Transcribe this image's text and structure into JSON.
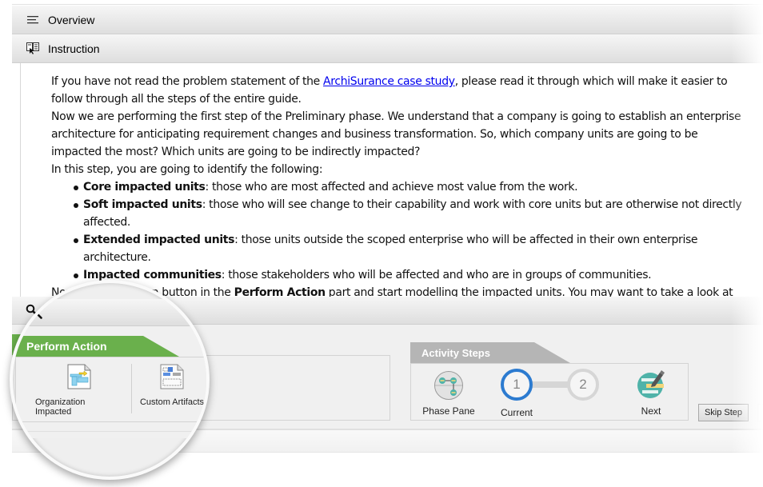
{
  "overview": {
    "title": "Overview",
    "icon": "menu-icon"
  },
  "instruction": {
    "title": "Instruction",
    "icon": "book-pointer-icon",
    "paragraphs": {
      "p1_before_link": "If you have not read the problem statement of the ",
      "p1_link": "ArchiSurance case study",
      "p1_after_link": ", please read it through which will make it easier to",
      "p1_line2": "follow through all the steps of the entire guide.",
      "p2_line1": "Now we are performing the first step of the Preliminary phase. We understand that a company is going to establish an enterprise",
      "p2_line2": "architecture for anticipating requirement changes and business transformation. So, which company units are going to be",
      "p2_line3": "impacted the most? Which units are going to be indirectly impacted?",
      "p3": "In this step, you are going to identify the following:"
    },
    "bullets": [
      {
        "term": "Core impacted units",
        "desc": ": those who are most affected and achieve most value from the work."
      },
      {
        "term": "Soft impacted units",
        "desc": ": those who will see change to their capability and work with core units but are otherwise not directly",
        "desc2": "affected."
      },
      {
        "term": "Extended impacted units",
        "desc": ": those units outside the scoped enterprise who will be affected in their own enterprise",
        "desc2": "architecture."
      },
      {
        "term": "Impacted communities",
        "desc": ": those stakeholders who will be affected and who are in groups of communities."
      }
    ],
    "last_line": {
      "before": "Now click the action button in the ",
      "bold": "Perform Action",
      "after": " part and start modelling the impacted units. You may want to take a look at"
    },
    "last_line_visible_start": "Now"
  },
  "search": {
    "icon": "search-icon"
  },
  "perform_action": {
    "title": "Perform Action",
    "tools": [
      {
        "label": "Organization Impacted",
        "icon": "organization-diagram-icon"
      },
      {
        "label": "Custom Artifacts",
        "icon": "custom-artifacts-icon"
      }
    ]
  },
  "activity_steps": {
    "title": "Activity Steps",
    "phase_pane": "Phase Pane",
    "steps": [
      {
        "number": "1",
        "label": "Current",
        "state": "current"
      },
      {
        "number": "2",
        "label": "",
        "state": "future"
      }
    ],
    "next": "Next"
  },
  "skip_step": "Skip Step",
  "colors": {
    "perform_green": "#6ab04c",
    "activity_gray": "#b5b5b5",
    "current_blue": "#2c7bd0",
    "link_blue": "#0000ee",
    "next_teal": "#4fb3a9"
  }
}
